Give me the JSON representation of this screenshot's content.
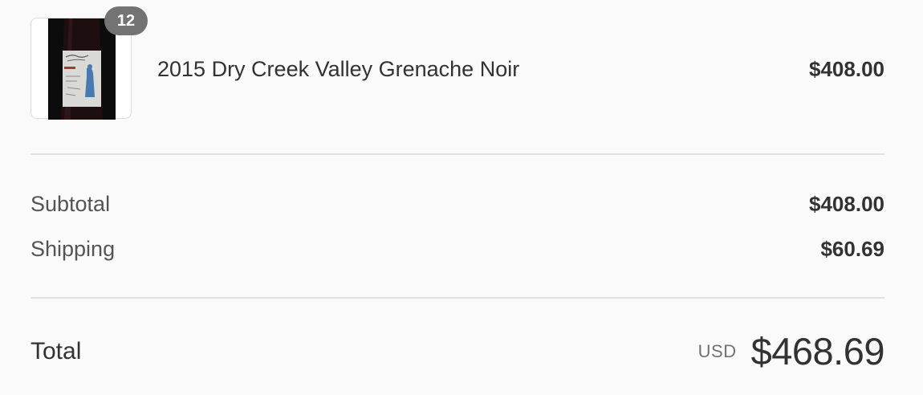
{
  "product": {
    "name": "2015 Dry Creek Valley Grenache Noir",
    "price": "$408.00",
    "quantity": "12",
    "thumbnail_icon": "wine-bottle-icon"
  },
  "lines": {
    "subtotal_label": "Subtotal",
    "subtotal_value": "$408.00",
    "shipping_label": "Shipping",
    "shipping_value": "$60.69"
  },
  "total": {
    "label": "Total",
    "currency": "USD",
    "amount": "$468.69"
  },
  "colors": {
    "background": "#fafafa",
    "text": "#323232",
    "muted": "#717171",
    "badge": "#737373",
    "divider": "#e1e1e1"
  }
}
